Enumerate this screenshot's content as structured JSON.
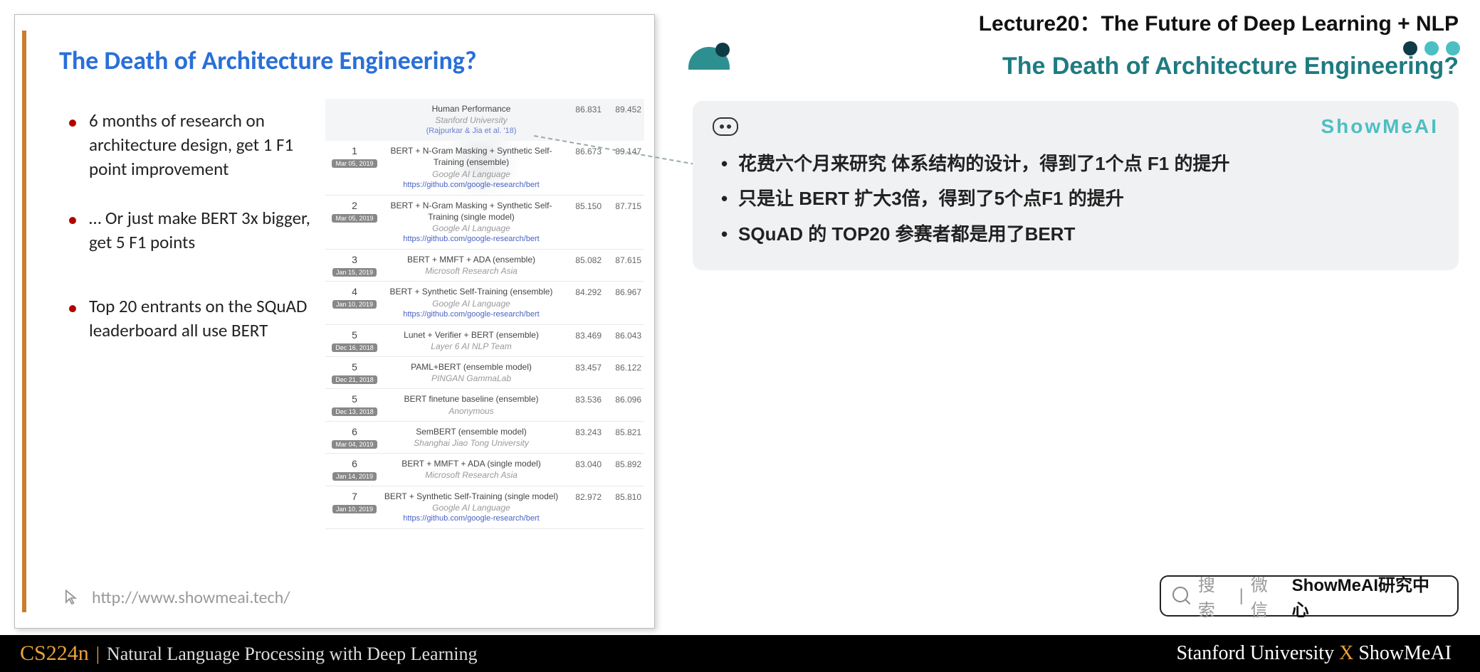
{
  "lecture_title": "Lecture20：The Future of Deep Learning + NLP",
  "section_title": "The Death of Architecture Engineering?",
  "brand": "ShowMeAI",
  "card_bullets": [
    "花费六个月来研究 体系结构的设计，得到了1个点 F1 的提升",
    "只是让 BERT 扩大3倍，得到了5个点F1 的提升",
    "SQuAD 的 TOP20 参赛者都是用了BERT"
  ],
  "search": {
    "hint_cn": "搜索",
    "sep": "|",
    "hint2": "微信",
    "bold": "ShowMeAI研究中心"
  },
  "footer": {
    "course_code": "CS224n",
    "course_name": "Natural Language Processing with Deep Learning",
    "right_a": "Stanford University",
    "right_x": "X",
    "right_b": "ShowMeAI"
  },
  "slide": {
    "title": "The Death of Architecture Engineering?",
    "bullets": [
      "6 months of research on architecture design, get 1 F1 point improvement",
      "… Or just make BERT 3x bigger, get 5 F1 points",
      "Top 20 entrants on the SQuAD leaderboard all use BERT"
    ],
    "link": "http://www.showmeai.tech/"
  },
  "leaderboard": {
    "header": {
      "name": "Human Performance",
      "org": "Stanford University",
      "link": "(Rajpurkar & Jia et al. '18)",
      "em": "86.831",
      "f1": "89.452"
    },
    "rows": [
      {
        "rank": "1",
        "date": "Mar 05, 2019",
        "name": "BERT + N-Gram Masking + Synthetic Self-Training (ensemble)",
        "org": "Google AI Language",
        "link": "https://github.com/google-research/bert",
        "em": "86.673",
        "f1": "89.147"
      },
      {
        "rank": "2",
        "date": "Mar 05, 2019",
        "name": "BERT + N-Gram Masking + Synthetic Self-Training (single model)",
        "org": "Google AI Language",
        "link": "https://github.com/google-research/bert",
        "em": "85.150",
        "f1": "87.715"
      },
      {
        "rank": "3",
        "date": "Jan 15, 2019",
        "name": "BERT + MMFT + ADA (ensemble)",
        "org": "Microsoft Research Asia",
        "link": "",
        "em": "85.082",
        "f1": "87.615"
      },
      {
        "rank": "4",
        "date": "Jan 10, 2019",
        "name": "BERT + Synthetic Self-Training (ensemble)",
        "org": "Google AI Language",
        "link": "https://github.com/google-research/bert",
        "em": "84.292",
        "f1": "86.967"
      },
      {
        "rank": "5",
        "date": "Dec 16, 2018",
        "name": "Lunet + Verifier + BERT (ensemble)",
        "org": "Layer 6 AI NLP Team",
        "link": "",
        "em": "83.469",
        "f1": "86.043"
      },
      {
        "rank": "5",
        "date": "Dec 21, 2018",
        "name": "PAML+BERT (ensemble model)",
        "org": "PINGAN GammaLab",
        "link": "",
        "em": "83.457",
        "f1": "86.122"
      },
      {
        "rank": "5",
        "date": "Dec 13, 2018",
        "name": "BERT finetune baseline (ensemble)",
        "org": "Anonymous",
        "link": "",
        "em": "83.536",
        "f1": "86.096"
      },
      {
        "rank": "6",
        "date": "Mar 04, 2019",
        "name": "SemBERT (ensemble model)",
        "org": "Shanghai Jiao Tong University",
        "link": "",
        "em": "83.243",
        "f1": "85.821"
      },
      {
        "rank": "6",
        "date": "Jan 14, 2019",
        "name": "BERT + MMFT + ADA (single model)",
        "org": "Microsoft Research Asia",
        "link": "",
        "em": "83.040",
        "f1": "85.892"
      },
      {
        "rank": "7",
        "date": "Jan 10, 2019",
        "name": "BERT + Synthetic Self-Training (single model)",
        "org": "Google AI Language",
        "link": "https://github.com/google-research/bert",
        "em": "82.972",
        "f1": "85.810"
      }
    ]
  }
}
